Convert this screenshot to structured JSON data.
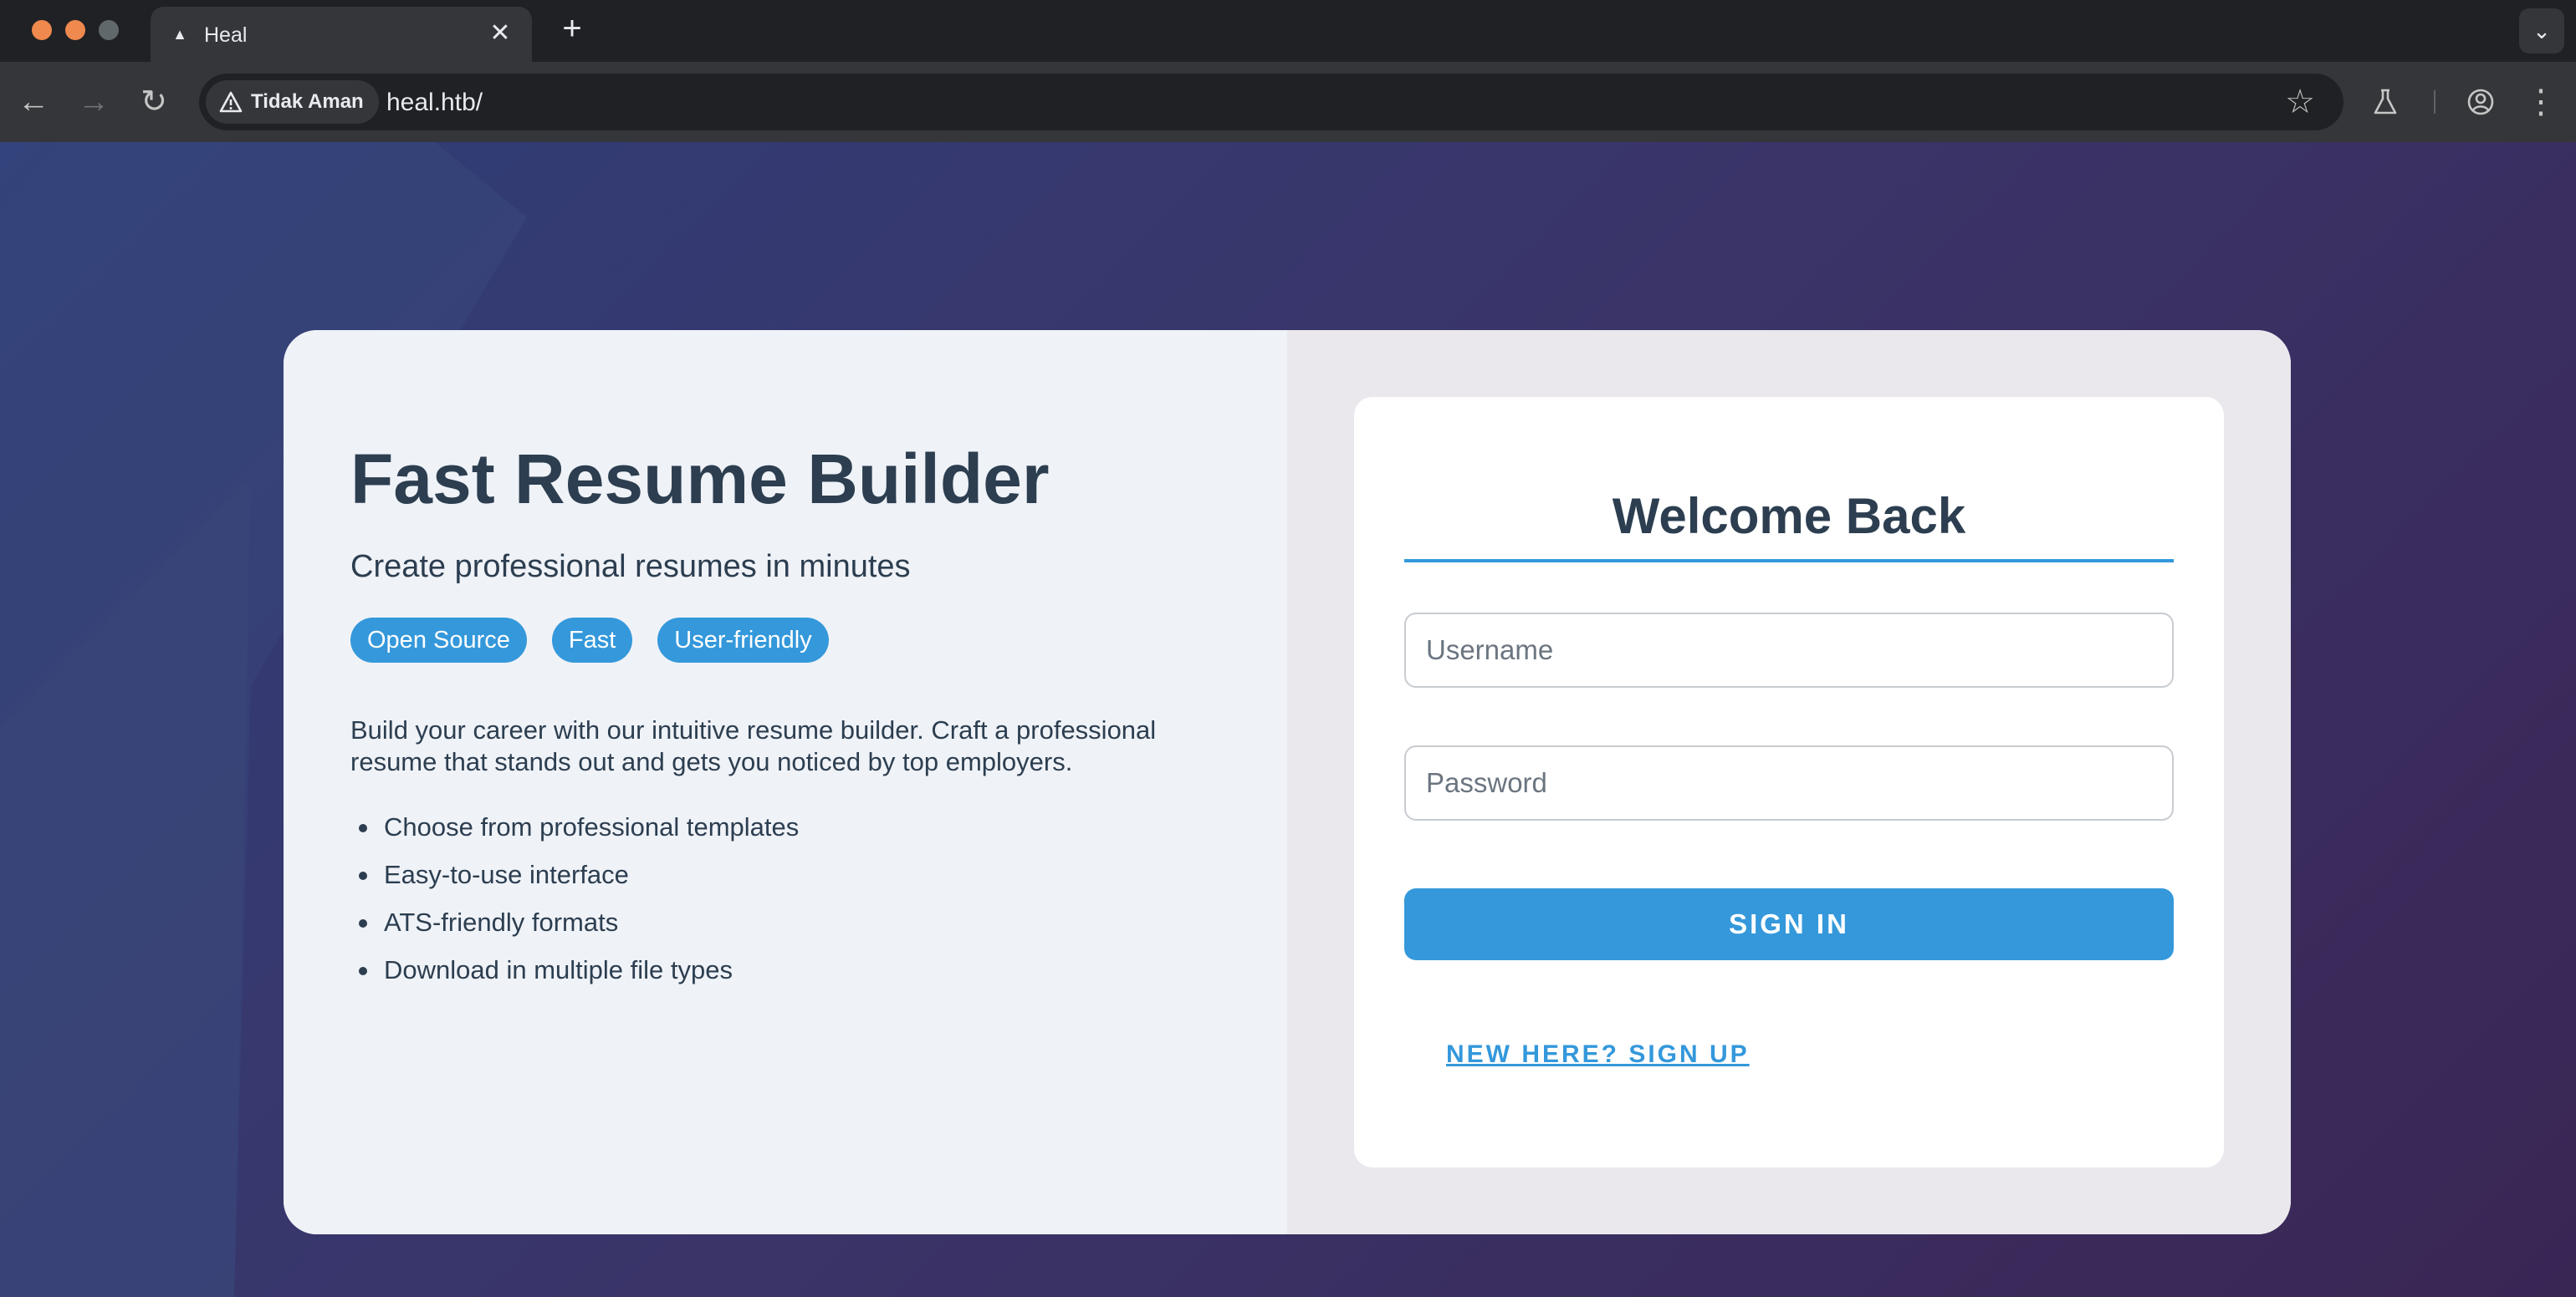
{
  "browser": {
    "tab_title": "Heal",
    "tab_close": "✕",
    "new_tab": "+",
    "security_label": "Tidak Aman",
    "url": "heal.htb/",
    "icons": {
      "back": "arrow-left-icon",
      "forward": "arrow-right-icon",
      "reload": "reload-icon",
      "warning": "warning-triangle-icon",
      "bookmark": "star-icon",
      "labs": "flask-icon",
      "profile": "profile-icon",
      "menu": "kebab-menu-icon",
      "tab_search": "chevron-down-icon"
    }
  },
  "hero": {
    "title": "Fast Resume Builder",
    "subtitle": "Create professional resumes in minutes",
    "tags": [
      "Open Source",
      "Fast",
      "User-friendly"
    ],
    "description": "Build your career with our intuitive resume builder. Craft a professional resume that stands out and gets you noticed by top employers.",
    "features": [
      "Choose from professional templates",
      "Easy-to-use interface",
      "ATS-friendly formats",
      "Download in multiple file types"
    ]
  },
  "login": {
    "title": "Welcome Back",
    "username_placeholder": "Username",
    "username_value": "",
    "password_placeholder": "Password",
    "password_value": "",
    "submit_label": "SIGN IN",
    "signup_label": "NEW HERE? SIGN UP"
  },
  "colors": {
    "accent": "#3498db",
    "text": "#2c3e50",
    "window_traffic_close": "#f0894d",
    "window_traffic_min": "#f0894d",
    "window_traffic_max": "#60686c"
  }
}
